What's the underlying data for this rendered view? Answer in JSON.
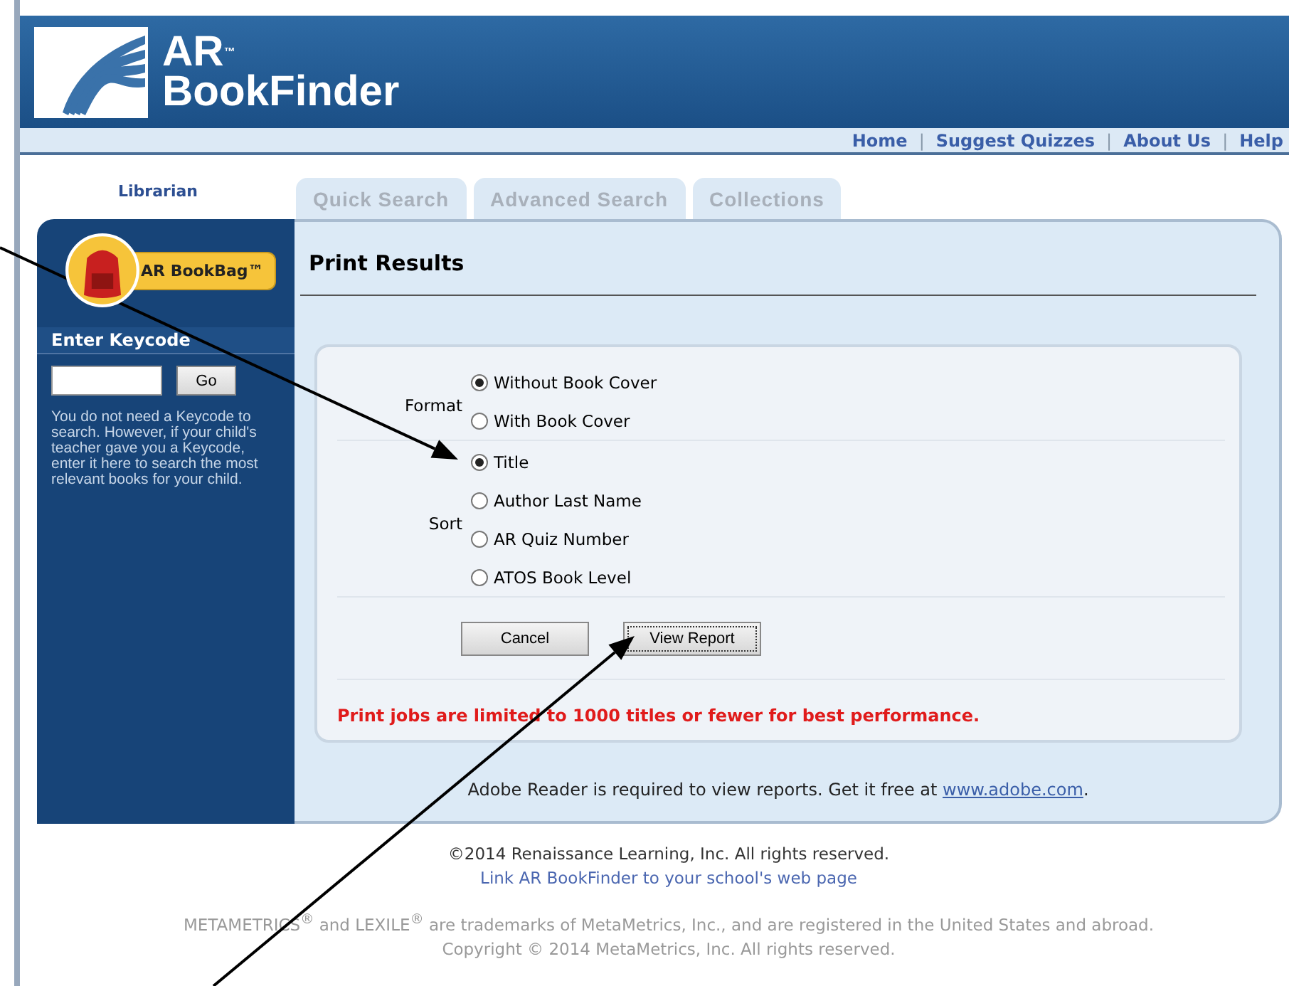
{
  "header": {
    "logo_top": "AR$^{™}$",
    "logo_bottom": "BookFinder"
  },
  "nav_links": [
    "Home",
    "Suggest Quizzes",
    "About Us",
    "Help"
  ],
  "nav_separator": "|",
  "user_role": "Librarian",
  "tabs": [
    {
      "label": "Quick Search",
      "selected": false
    },
    {
      "label": "Advanced Search",
      "selected": false
    },
    {
      "label": "Collections",
      "selected": false
    }
  ],
  "sidebar": {
    "bookbag_button": "AR BookBag™",
    "keycode_heading": "Enter Keycode",
    "go_button": "Go",
    "help_text": "You do not need a Keycode to search. However, if your child's teacher gave you a Keycode, enter it here to search the most relevant books for your child."
  },
  "panel": {
    "title": "Print Results",
    "groups": [
      {
        "label": "Format",
        "options": [
          {
            "label": "Without Book Cover",
            "selected": true
          },
          {
            "label": "With Book Cover",
            "selected": false
          }
        ]
      },
      {
        "label": "Sort",
        "options": [
          {
            "label": "Title",
            "selected": true
          },
          {
            "label": "Author Last Name",
            "selected": false
          },
          {
            "label": "AR Quiz Number",
            "selected": false
          },
          {
            "label": "ATOS Book Level",
            "selected": false
          }
        ]
      }
    ],
    "buttons": [
      {
        "label": "Cancel",
        "focused": false
      },
      {
        "label": "View Report",
        "focused": true
      }
    ],
    "warning": "Print jobs are limited to 1000 titles or fewer for best performance.",
    "adobe_note": "Adobe Reader is required to view reports. Get it free at ",
    "adobe_link": "www.adobe.com",
    "adobe_end": "."
  },
  "footer": {
    "copyright": "©2014 Renaissance Learning, Inc. All rights reserved.",
    "link": "Link AR BookFinder to your school's web page",
    "trademark": "METAMETRICS$^{®}$ and LEXILE$^{®}$ are trademarks of MetaMetrics, Inc., and are registered in the United States and abroad.",
    "copyright2": "Copyright © 2014 MetaMetrics, Inc. All rights reserved."
  },
  "annotations": [
    {
      "kind": "arrow"
    },
    {
      "kind": "arrow"
    }
  ]
}
